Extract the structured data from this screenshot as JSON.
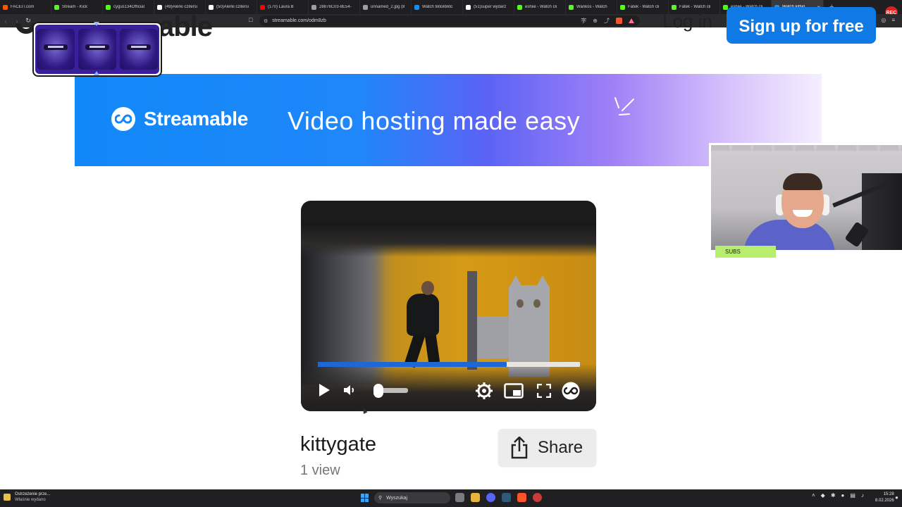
{
  "browser": {
    "tabs": [
      {
        "label": "FACEIT.com",
        "icon": "faceit-icon",
        "color": "#ff5500"
      },
      {
        "label": "Stream - Kick",
        "icon": "kick-icon",
        "color": "#53fc18"
      },
      {
        "label": "cygus134Official",
        "icon": "kick-icon",
        "color": "#53fc18"
      },
      {
        "label": "(49)Alerki czitersi",
        "icon": "tiktok-icon",
        "color": "#ffffff"
      },
      {
        "label": "(50)Alerki czitersi",
        "icon": "tiktok-icon",
        "color": "#ffffff"
      },
      {
        "label": "(170) Laura B",
        "icon": "youtube-icon",
        "color": "#ff0000"
      },
      {
        "label": "28876C03-8E54-",
        "icon": "globe-icon",
        "color": "#9aa0a6"
      },
      {
        "label": "unnamed_2.jpg (8",
        "icon": "globe-icon",
        "color": "#9aa0a6"
      },
      {
        "label": "Watch tiktoktikto",
        "icon": "streamable-icon",
        "color": "#0f90fa"
      },
      {
        "label": "(51)super wydarz",
        "icon": "tiktok-icon",
        "color": "#ffffff"
      },
      {
        "label": "eshiie - Watch cli",
        "icon": "kick-icon",
        "color": "#53fc18"
      },
      {
        "label": "Wankos - Watch",
        "icon": "kick-icon",
        "color": "#53fc18"
      },
      {
        "label": "Fatek - Watch cli",
        "icon": "kick-icon",
        "color": "#53fc18"
      },
      {
        "label": "Fatek - Watch cli",
        "icon": "kick-icon",
        "color": "#53fc18"
      },
      {
        "label": "eshiie - Watch cli",
        "icon": "kick-icon",
        "color": "#53fc18"
      },
      {
        "label": "Watch kittyg",
        "icon": "streamable-icon",
        "color": "#0f90fa",
        "active": true
      }
    ],
    "url": "streamable.com/odm8zb",
    "new_tab": "+",
    "rec_badge": "REC"
  },
  "page": {
    "logo_peek": "able",
    "login_label": "Log in",
    "signup_label": "Sign up for free",
    "banner": {
      "brand": "Streamable",
      "tagline": "Video hosting made easy"
    },
    "video": {
      "title": "kittygate",
      "views": "1 view",
      "progress": 0.72,
      "volume": 0.05
    },
    "share_label": "Share"
  },
  "overlays": {
    "subs_label": "SUBS"
  },
  "taskbar": {
    "notification_title": "Ostrzeżenie prze...",
    "notification_sub": "Właśnie wydano",
    "search_placeholder": "Wyszukaj",
    "time": "15:28",
    "date": "8.02.2026"
  }
}
